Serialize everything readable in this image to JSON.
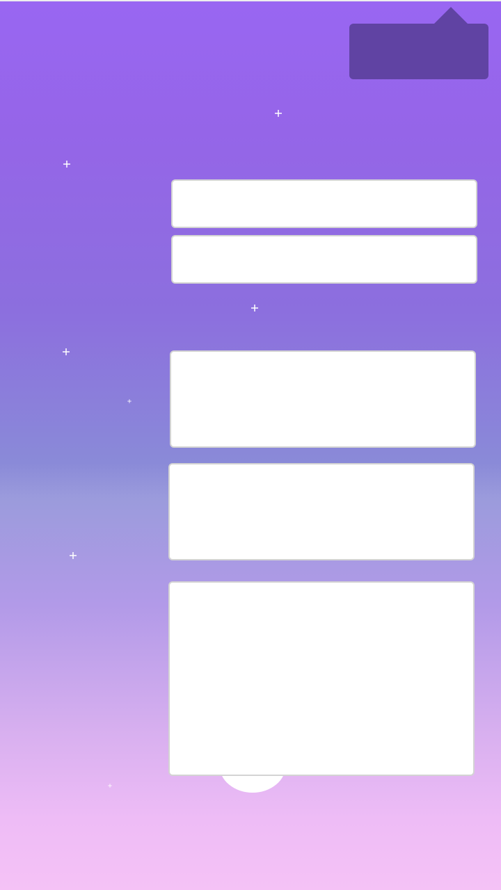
{
  "app": {
    "title": "",
    "background": {
      "gradient_colors": [
        "#9966f2",
        "#8c6fde",
        "#8a8ad8",
        "#b29ae8",
        "#f5c2f6"
      ]
    }
  },
  "tooltip": {
    "text": "",
    "color": "#6043a3"
  },
  "form": {
    "field_1": {
      "value": "",
      "placeholder": ""
    },
    "field_2": {
      "value": "",
      "placeholder": ""
    },
    "panel_1": {
      "text": ""
    },
    "panel_2": {
      "text": ""
    },
    "panel_3": {
      "text": ""
    }
  },
  "decorations": {
    "icons": [
      "sparkle-icon",
      "moon-icon"
    ]
  }
}
